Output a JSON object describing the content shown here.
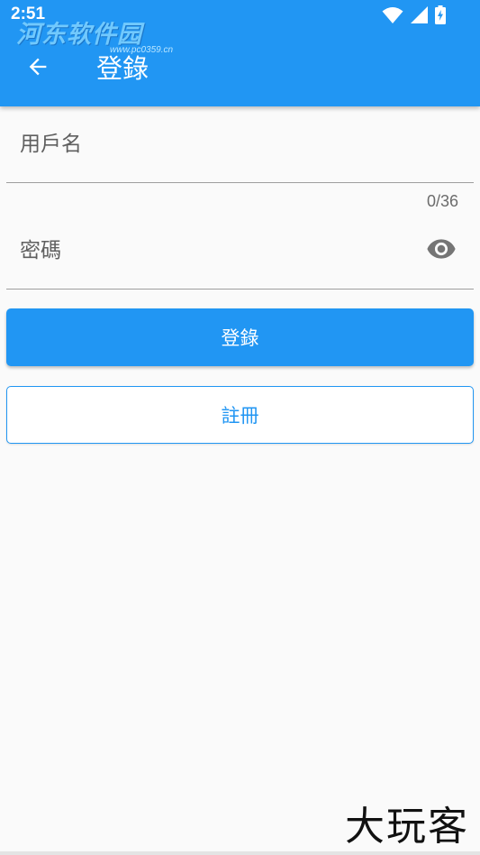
{
  "status_bar": {
    "time": "2:51",
    "icons": [
      "wifi-icon",
      "signal-icon",
      "battery-charging-icon"
    ]
  },
  "watermark_top": {
    "text": "河东软件园",
    "sub": "www.pc0359.cn"
  },
  "app_bar": {
    "back_icon": "arrow-left-icon",
    "title": "登錄"
  },
  "form": {
    "username": {
      "placeholder": "用戶名",
      "value": "",
      "counter": "0/36"
    },
    "password": {
      "placeholder": "密碼",
      "value": "",
      "toggle_icon": "eye-icon"
    }
  },
  "buttons": {
    "login_label": "登錄",
    "register_label": "註冊"
  },
  "watermark_bottom": {
    "text": "大玩客"
  },
  "colors": {
    "primary": "#2196f3",
    "background": "#fafafa",
    "white": "#ffffff"
  }
}
